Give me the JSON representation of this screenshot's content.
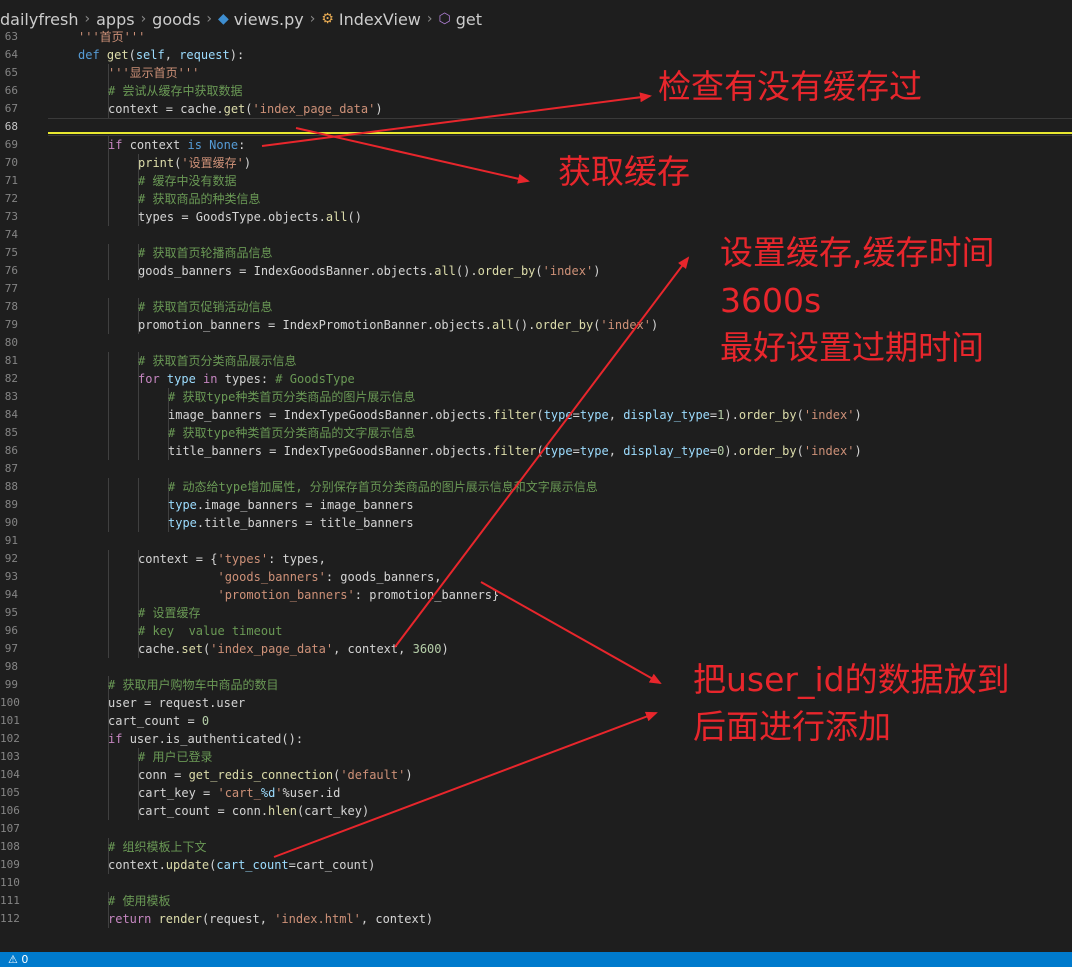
{
  "breadcrumb": {
    "items": [
      {
        "label": "dailyfresh",
        "icon": ""
      },
      {
        "label": "apps",
        "icon": ""
      },
      {
        "label": "goods",
        "icon": ""
      },
      {
        "label": "views.py",
        "icon": "python-file-icon"
      },
      {
        "label": "IndexView",
        "icon": "class-icon"
      },
      {
        "label": "get",
        "icon": "method-cube-icon"
      }
    ]
  },
  "editor": {
    "current_line": 68,
    "lines": [
      {
        "n": 63,
        "ind": 1,
        "t": [
          [
            "str",
            "'''首页'''"
          ]
        ]
      },
      {
        "n": 64,
        "ind": 1,
        "t": [
          [
            "kw",
            "def "
          ],
          [
            "fn",
            "get"
          ],
          [
            "txt",
            "("
          ],
          [
            "var",
            "self"
          ],
          [
            "txt",
            ", "
          ],
          [
            "var",
            "request"
          ],
          [
            "txt",
            "):"
          ]
        ]
      },
      {
        "n": 65,
        "ind": 2,
        "t": [
          [
            "str",
            "'''显示首页'''"
          ]
        ]
      },
      {
        "n": 66,
        "ind": 2,
        "t": [
          [
            "cm",
            "# 尝试从缓存中获取数据"
          ]
        ]
      },
      {
        "n": 67,
        "ind": 2,
        "t": [
          [
            "txt",
            "context = cache."
          ],
          [
            "fn",
            "get"
          ],
          [
            "txt",
            "("
          ],
          [
            "str",
            "'index_page_data'"
          ],
          [
            "txt",
            ")"
          ]
        ]
      },
      {
        "n": 68,
        "ind": 0,
        "t": []
      },
      {
        "n": 69,
        "ind": 2,
        "t": [
          [
            "ctl",
            "if "
          ],
          [
            "txt",
            "context "
          ],
          [
            "kw",
            "is None"
          ],
          [
            "txt",
            ":"
          ]
        ]
      },
      {
        "n": 70,
        "ind": 3,
        "t": [
          [
            "fn",
            "print"
          ],
          [
            "txt",
            "("
          ],
          [
            "str",
            "'设置缓存'"
          ],
          [
            "txt",
            ")"
          ]
        ]
      },
      {
        "n": 71,
        "ind": 3,
        "t": [
          [
            "cm",
            "# 缓存中没有数据"
          ]
        ]
      },
      {
        "n": 72,
        "ind": 3,
        "t": [
          [
            "cm",
            "# 获取商品的种类信息"
          ]
        ]
      },
      {
        "n": 73,
        "ind": 3,
        "t": [
          [
            "txt",
            "types = GoodsType.objects."
          ],
          [
            "fn",
            "all"
          ],
          [
            "txt",
            "()"
          ]
        ]
      },
      {
        "n": 74,
        "ind": 0,
        "t": []
      },
      {
        "n": 75,
        "ind": 3,
        "t": [
          [
            "cm",
            "# 获取首页轮播商品信息"
          ]
        ]
      },
      {
        "n": 76,
        "ind": 3,
        "t": [
          [
            "txt",
            "goods_banners = IndexGoodsBanner.objects."
          ],
          [
            "fn",
            "all"
          ],
          [
            "txt",
            "()."
          ],
          [
            "fn",
            "order_by"
          ],
          [
            "txt",
            "("
          ],
          [
            "str",
            "'index'"
          ],
          [
            "txt",
            ")"
          ]
        ]
      },
      {
        "n": 77,
        "ind": 0,
        "t": []
      },
      {
        "n": 78,
        "ind": 3,
        "t": [
          [
            "cm",
            "# 获取首页促销活动信息"
          ]
        ]
      },
      {
        "n": 79,
        "ind": 3,
        "t": [
          [
            "txt",
            "promotion_banners = IndexPromotionBanner.objects."
          ],
          [
            "fn",
            "all"
          ],
          [
            "txt",
            "()."
          ],
          [
            "fn",
            "order_by"
          ],
          [
            "txt",
            "("
          ],
          [
            "str",
            "'index'"
          ],
          [
            "txt",
            ")"
          ]
        ]
      },
      {
        "n": 80,
        "ind": 0,
        "t": []
      },
      {
        "n": 81,
        "ind": 3,
        "t": [
          [
            "cm",
            "# 获取首页分类商品展示信息"
          ]
        ]
      },
      {
        "n": 82,
        "ind": 3,
        "t": [
          [
            "ctl",
            "for "
          ],
          [
            "var",
            "type"
          ],
          [
            "ctl",
            " in "
          ],
          [
            "txt",
            "types: "
          ],
          [
            "cm",
            "# GoodsType"
          ]
        ]
      },
      {
        "n": 83,
        "ind": 4,
        "t": [
          [
            "cm",
            "# 获取type种类首页分类商品的图片展示信息"
          ]
        ]
      },
      {
        "n": 84,
        "ind": 4,
        "t": [
          [
            "txt",
            "image_banners = IndexTypeGoodsBanner.objects."
          ],
          [
            "fn",
            "filter"
          ],
          [
            "txt",
            "("
          ],
          [
            "var",
            "type"
          ],
          [
            "txt",
            "="
          ],
          [
            "var",
            "type"
          ],
          [
            "txt",
            ", "
          ],
          [
            "var",
            "display_type"
          ],
          [
            "txt",
            "="
          ],
          [
            "num",
            "1"
          ],
          [
            "txt",
            ")."
          ],
          [
            "fn",
            "order_by"
          ],
          [
            "txt",
            "("
          ],
          [
            "str",
            "'index'"
          ],
          [
            "txt",
            ")"
          ]
        ]
      },
      {
        "n": 85,
        "ind": 4,
        "t": [
          [
            "cm",
            "# 获取type种类首页分类商品的文字展示信息"
          ]
        ]
      },
      {
        "n": 86,
        "ind": 4,
        "t": [
          [
            "txt",
            "title_banners = IndexTypeGoodsBanner.objects."
          ],
          [
            "fn",
            "filter"
          ],
          [
            "txt",
            "("
          ],
          [
            "var",
            "type"
          ],
          [
            "txt",
            "="
          ],
          [
            "var",
            "type"
          ],
          [
            "txt",
            ", "
          ],
          [
            "var",
            "display_type"
          ],
          [
            "txt",
            "="
          ],
          [
            "num",
            "0"
          ],
          [
            "txt",
            ")."
          ],
          [
            "fn",
            "order_by"
          ],
          [
            "txt",
            "("
          ],
          [
            "str",
            "'index'"
          ],
          [
            "txt",
            ")"
          ]
        ]
      },
      {
        "n": 87,
        "ind": 0,
        "t": []
      },
      {
        "n": 88,
        "ind": 4,
        "t": [
          [
            "cm",
            "# 动态给type增加属性, 分别保存首页分类商品的图片展示信息和文字展示信息"
          ]
        ]
      },
      {
        "n": 89,
        "ind": 4,
        "t": [
          [
            "var",
            "type"
          ],
          [
            "txt",
            ".image_banners = image_banners"
          ]
        ]
      },
      {
        "n": 90,
        "ind": 4,
        "t": [
          [
            "var",
            "type"
          ],
          [
            "txt",
            ".title_banners = title_banners"
          ]
        ]
      },
      {
        "n": 91,
        "ind": 0,
        "t": []
      },
      {
        "n": 92,
        "ind": 3,
        "t": [
          [
            "txt",
            "context = {"
          ],
          [
            "str",
            "'types'"
          ],
          [
            "txt",
            ": types,"
          ]
        ]
      },
      {
        "n": 93,
        "ind": 3,
        "t": [
          [
            "txt",
            "           "
          ],
          [
            "str",
            "'goods_banners'"
          ],
          [
            "txt",
            ": goods_banners,"
          ]
        ]
      },
      {
        "n": 94,
        "ind": 3,
        "t": [
          [
            "txt",
            "           "
          ],
          [
            "str",
            "'promotion_banners'"
          ],
          [
            "txt",
            ": promotion_banners}"
          ]
        ]
      },
      {
        "n": 95,
        "ind": 3,
        "t": [
          [
            "cm",
            "# 设置缓存"
          ]
        ]
      },
      {
        "n": 96,
        "ind": 3,
        "t": [
          [
            "cm",
            "# key  value timeout"
          ]
        ]
      },
      {
        "n": 97,
        "ind": 3,
        "t": [
          [
            "txt",
            "cache."
          ],
          [
            "fn",
            "set"
          ],
          [
            "txt",
            "("
          ],
          [
            "str",
            "'index_page_data'"
          ],
          [
            "txt",
            ", context, "
          ],
          [
            "num",
            "3600"
          ],
          [
            "txt",
            ")"
          ]
        ]
      },
      {
        "n": 98,
        "ind": 0,
        "t": []
      },
      {
        "n": 99,
        "ind": 2,
        "t": [
          [
            "cm",
            "# 获取用户购物车中商品的数目"
          ]
        ]
      },
      {
        "n": 100,
        "ind": 2,
        "t": [
          [
            "txt",
            "user = request.user"
          ]
        ]
      },
      {
        "n": 101,
        "ind": 2,
        "t": [
          [
            "txt",
            "cart_count = "
          ],
          [
            "num",
            "0"
          ]
        ]
      },
      {
        "n": 102,
        "ind": 2,
        "t": [
          [
            "ctl",
            "if "
          ],
          [
            "txt",
            "user.is_authenticated():"
          ]
        ]
      },
      {
        "n": 103,
        "ind": 3,
        "t": [
          [
            "cm",
            "# 用户已登录"
          ]
        ]
      },
      {
        "n": 104,
        "ind": 3,
        "t": [
          [
            "txt",
            "conn = "
          ],
          [
            "fn",
            "get_redis_connection"
          ],
          [
            "txt",
            "("
          ],
          [
            "str",
            "'default'"
          ],
          [
            "txt",
            ")"
          ]
        ]
      },
      {
        "n": 105,
        "ind": 3,
        "t": [
          [
            "txt",
            "cart_key = "
          ],
          [
            "str",
            "'cart_"
          ],
          [
            "var",
            "%d"
          ],
          [
            "str",
            "'"
          ],
          [
            "txt",
            "%user.id"
          ]
        ]
      },
      {
        "n": 106,
        "ind": 3,
        "t": [
          [
            "txt",
            "cart_count = conn."
          ],
          [
            "fn",
            "hlen"
          ],
          [
            "txt",
            "(cart_key)"
          ]
        ]
      },
      {
        "n": 107,
        "ind": 0,
        "t": []
      },
      {
        "n": 108,
        "ind": 2,
        "t": [
          [
            "cm",
            "# 组织模板上下文"
          ]
        ]
      },
      {
        "n": 109,
        "ind": 2,
        "t": [
          [
            "txt",
            "context."
          ],
          [
            "fn",
            "update"
          ],
          [
            "txt",
            "("
          ],
          [
            "var",
            "cart_count"
          ],
          [
            "txt",
            "=cart_count)"
          ]
        ]
      },
      {
        "n": 110,
        "ind": 0,
        "t": []
      },
      {
        "n": 111,
        "ind": 2,
        "t": [
          [
            "cm",
            "# 使用模板"
          ]
        ]
      },
      {
        "n": 112,
        "ind": 2,
        "t": [
          [
            "ctl",
            "return "
          ],
          [
            "fn",
            "render"
          ],
          [
            "txt",
            "(request, "
          ],
          [
            "str",
            "'index.html'"
          ],
          [
            "txt",
            ", context)"
          ]
        ]
      }
    ]
  },
  "annotations": {
    "check_cache": "检查有没有缓存过",
    "get_cache": "获取缓存",
    "set_cache_1": "设置缓存,缓存时间",
    "set_cache_2": "3600s",
    "set_cache_3": "最好设置过期时间",
    "user_id_1": "把user_id的数据放到",
    "user_id_2": "后面进行添加",
    "annotation_color": "#e8262c"
  },
  "status_bar": {
    "warnings": "⚠ 0",
    "color": "#007acc"
  }
}
